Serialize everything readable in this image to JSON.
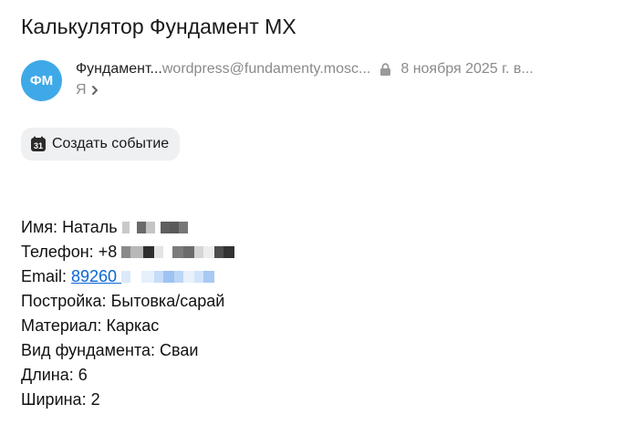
{
  "subject": "Калькулятор Фундамент МХ",
  "sender": {
    "initials": "ФМ",
    "name": "Фундамент...",
    "email": "wordpress@fundamenty.mosc...",
    "date": "8 ноября 2025 г. в...",
    "recipient": "Я"
  },
  "actions": {
    "create_event_label": "Создать событие",
    "calendar_day": "31"
  },
  "message": {
    "name_label": "Имя: ",
    "name_value": "Наталь",
    "phone_label": "Телефон: ",
    "phone_value": "+8",
    "email_label": "Email: ",
    "email_value": "89260",
    "building_label": "Постройка: ",
    "building_value": "Бытовка/сарай",
    "material_label": "Материал: ",
    "material_value": "Каркас",
    "foundation_label": "Вид фундамента: ",
    "foundation_value": "Сваи",
    "length_label": "Длина: ",
    "length_value": "6",
    "width_label": "Ширина: ",
    "width_value": "2"
  },
  "colors": {
    "avatar": "#3fa9e8",
    "link": "#0a66d8",
    "muted": "#8a8a8a",
    "button_bg": "#eef0f2"
  },
  "icons": [
    "lock-icon",
    "chevron-right-icon",
    "calendar-icon"
  ]
}
